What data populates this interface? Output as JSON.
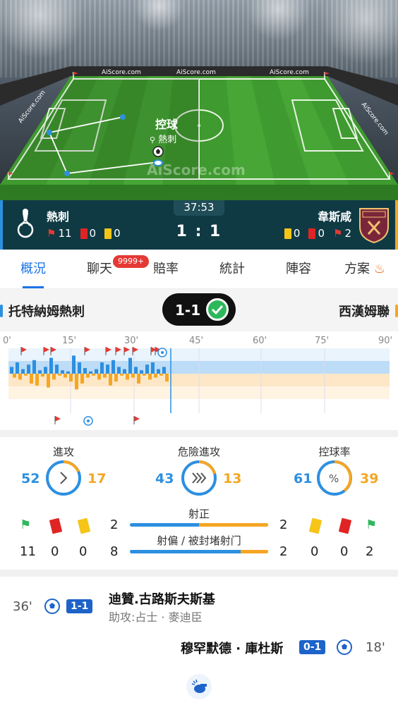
{
  "pitch": {
    "watermarks": [
      "AiScore.com",
      "AiScore.com",
      "AiScore.com",
      "AiScore.com",
      "AiScore.com",
      "AiScore.com"
    ],
    "status_label": "控球",
    "status_team": "熱刺"
  },
  "match": {
    "clock": "37:53",
    "score": "1 : 1",
    "home": {
      "name": "熱刺",
      "corners": "11",
      "red": "0",
      "yellow": "0",
      "color": "#2d8fe0"
    },
    "away": {
      "name": "韋斯咸",
      "corners": "2",
      "red": "0",
      "yellow": "0",
      "color": "#f5a623"
    }
  },
  "tabs": [
    {
      "label": "概況",
      "active": true
    },
    {
      "label": "聊天",
      "badge": "9999+"
    },
    {
      "label": "賠率"
    },
    {
      "label": "統計"
    },
    {
      "label": "陣容"
    },
    {
      "label": "方案",
      "icon": "flame-icon"
    }
  ],
  "teams": {
    "home_full": "托特納姆熱刺",
    "away_full": "西漢姆聯",
    "result": "1-1"
  },
  "timeline": {
    "ticks": [
      "0'",
      "15'",
      "30'",
      "45'",
      "60'",
      "75'",
      "90'"
    ],
    "current_minute": 38
  },
  "stats": {
    "attack": {
      "label": "進攻",
      "home": "52",
      "away": "17"
    },
    "dangerous": {
      "label": "危險進攻",
      "home": "43",
      "away": "13"
    },
    "possession": {
      "label": "控球率",
      "home": "61",
      "away": "39"
    },
    "shots_on": {
      "label": "射正",
      "home": "2",
      "away": "2"
    },
    "shots_off": {
      "label": "射偏 / 被封堵射门",
      "home": "8",
      "away": "2"
    },
    "home_corners": "11",
    "home_red": "0",
    "home_yellow": "0",
    "away_yellow": "0",
    "away_red": "0",
    "away_corners": "2"
  },
  "events": [
    {
      "minute": "36'",
      "score": "1-1",
      "player": "迪贊.古路斯夫斯基",
      "assist": "助攻:占士 · 麥迪臣"
    },
    {
      "minute": "18'",
      "score": "0-1",
      "player": "穆罕默德 · 庫杜斯"
    }
  ]
}
